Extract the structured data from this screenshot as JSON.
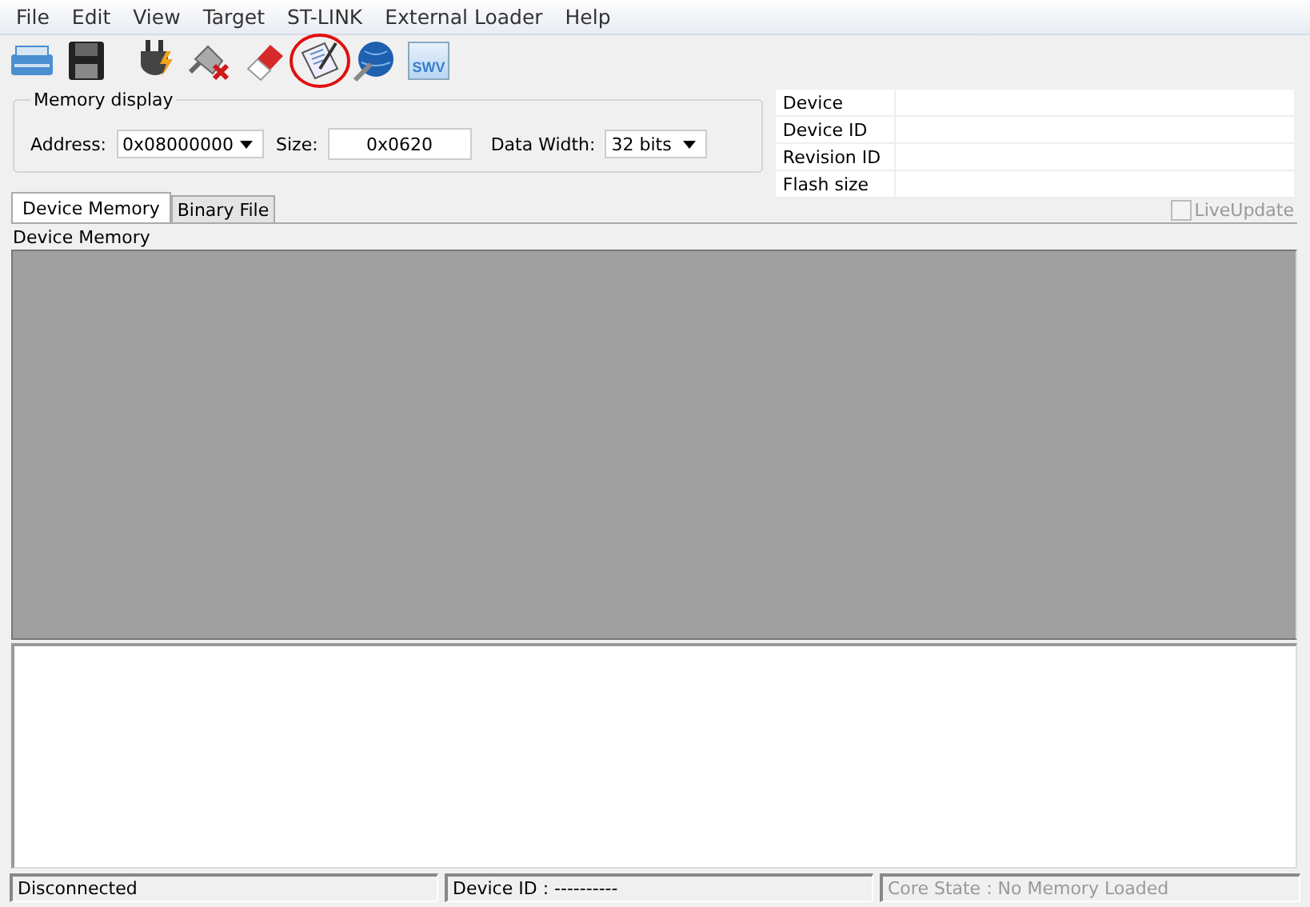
{
  "menu": [
    "File",
    "Edit",
    "View",
    "Target",
    "ST-LINK",
    "External Loader",
    "Help"
  ],
  "toolbar": [
    {
      "kind": "open",
      "highlighted": false
    },
    {
      "kind": "save",
      "highlighted": false
    },
    {
      "kind": "connect",
      "highlighted": false
    },
    {
      "kind": "disconnect",
      "highlighted": false
    },
    {
      "kind": "erase",
      "highlighted": false
    },
    {
      "kind": "program",
      "highlighted": true
    },
    {
      "kind": "settings",
      "highlighted": false
    },
    {
      "kind": "swv",
      "label": "SWV",
      "highlighted": false
    }
  ],
  "memory_display": {
    "title": "Memory display",
    "address_label": "Address:",
    "address": "0x08000000",
    "size_label": "Size:",
    "size": "0x0620",
    "width_label": "Data Width:",
    "width": "32 bits"
  },
  "device_info": [
    {
      "label": "Device"
    },
    {
      "label": "Device ID"
    },
    {
      "label": "Revision ID"
    },
    {
      "label": "Flash size"
    }
  ],
  "tabs": [
    {
      "label": "Device Memory",
      "selected": true
    },
    {
      "label": "Binary File",
      "selected": false
    }
  ],
  "live_update": {
    "label": "LiveUpdate",
    "checked": false,
    "disabled": true
  },
  "panel_title": "Device Memory",
  "status_bar": [
    {
      "text": "Disconnected",
      "disabled": false
    },
    {
      "text": "Device ID : ----------",
      "disabled": false
    },
    {
      "text": "Core State : No Memory Loaded",
      "disabled": true
    }
  ]
}
